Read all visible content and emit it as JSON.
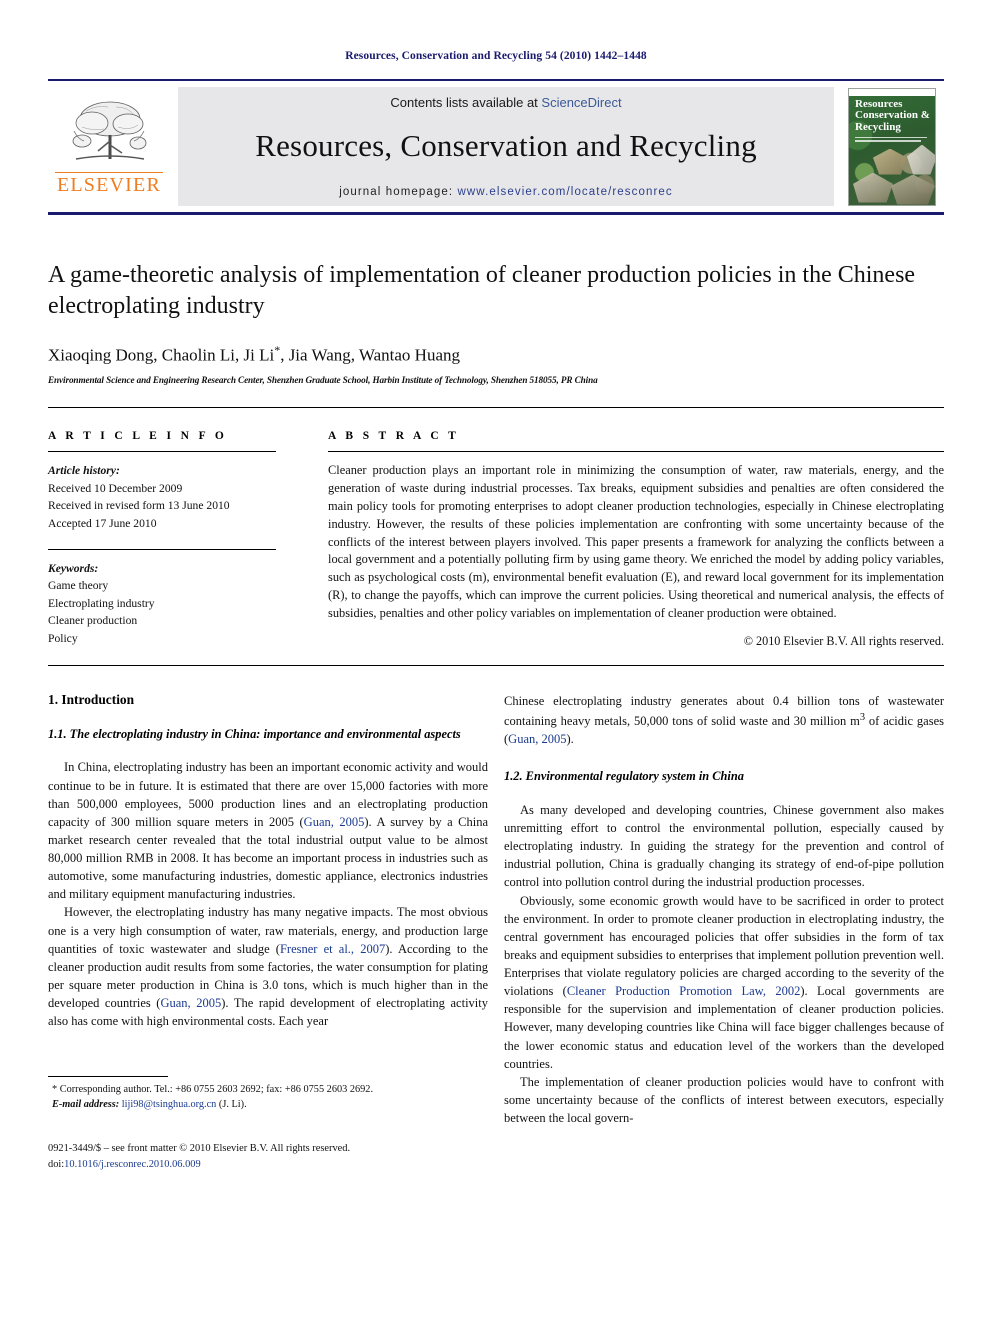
{
  "running_head": "Resources, Conservation and Recycling 54 (2010) 1442–1448",
  "masthead": {
    "publisher_name": "ELSEVIER",
    "contents_prefix": "Contents lists available at ",
    "contents_link": "ScienceDirect",
    "journal_name": "Resources, Conservation and Recycling",
    "homepage_label": "journal homepage:",
    "homepage_url": "www.elsevier.com/locate/resconrec",
    "cover_title_line1": "Resources",
    "cover_title_line2": "Conservation &",
    "cover_title_line3": "Recycling",
    "accent_color": "#1a1a6e",
    "logo_color": "#ef7d21"
  },
  "article": {
    "title": "A game-theoretic analysis of implementation of cleaner production policies in the Chinese electroplating industry",
    "authors": "Xiaoqing Dong, Chaolin Li, Ji Li",
    "authors_marker": "*",
    "authors_rest": ", Jia Wang, Wantao Huang",
    "affiliation": "Environmental Science and Engineering Research Center, Shenzhen Graduate School, Harbin Institute of Technology, Shenzhen 518055, PR China"
  },
  "article_info": {
    "heading": "A R T I C L E   I N F O",
    "history_label": "Article history:",
    "history": [
      "Received 10 December 2009",
      "Received in revised form 13 June 2010",
      "Accepted 17 June 2010"
    ],
    "keywords_label": "Keywords:",
    "keywords": [
      "Game theory",
      "Electroplating industry",
      "Cleaner production",
      "Policy"
    ]
  },
  "abstract": {
    "heading": "A B S T R A C T",
    "text": "Cleaner production plays an important role in minimizing the consumption of water, raw materials, energy, and the generation of waste during industrial processes. Tax breaks, equipment subsidies and penalties are often considered the main policy tools for promoting enterprises to adopt cleaner production technologies, especially in Chinese electroplating industry. However, the results of these policies implementation are confronting with some uncertainty because of the conflicts of the interest between players involved. This paper presents a framework for analyzing the conflicts between a local government and a potentially polluting firm by using game theory. We enriched the model by adding policy variables, such as psychological costs (m), environmental benefit evaluation (E), and reward local government for its implementation (R), to change the payoffs, which can improve the current policies. Using theoretical and numerical analysis, the effects of subsidies, penalties and other policy variables on implementation of cleaner production were obtained.",
    "copyright": "© 2010 Elsevier B.V. All rights reserved."
  },
  "sections": {
    "intro_heading": "1.  Introduction",
    "sub_1_1": "1.1.  The electroplating industry in China: importance and environmental aspects",
    "sub_1_2": "1.2.  Environmental regulatory system in China"
  },
  "paragraphs": {
    "left_p1_a": "In China, electroplating industry has been an important economic activity and would continue to be in future. It is estimated that there are over 15,000 factories with more than 500,000 employees, 5000 production lines and an electroplating production capacity of 300 million square meters in 2005 (",
    "left_p1_cite1": "Guan, 2005",
    "left_p1_b": "). A survey by a China market research center revealed that the total industrial output value to be almost 80,000 million RMB in 2008. It has become an important process in industries such as automotive, some manufacturing industries, domestic appliance, electronics industries and military equipment manufacturing industries.",
    "left_p2_a": "However, the electroplating industry has many negative impacts. The most obvious one is a very high consumption of water, raw materials, energy, and production large quantities of toxic wastewater and sludge (",
    "left_p2_cite1": "Fresner et al., 2007",
    "left_p2_b": "). According to the cleaner production audit results from some factories, the water consumption for plating per square meter production in China is 3.0 tons, which is much higher than in the developed countries (",
    "left_p2_cite2": "Guan, 2005",
    "left_p2_c": "). The rapid development of electroplating activity also has come with high environmental costs. Each year",
    "right_p1_a": "Chinese electroplating industry generates about 0.4 billion tons of wastewater containing heavy metals, 50,000 tons of solid waste and 30 million m",
    "right_p1_sup": "3",
    "right_p1_b": " of acidic gases (",
    "right_p1_cite": "Guan, 2005",
    "right_p1_c": ").",
    "right_p2": "As many developed and developing countries, Chinese government also makes unremitting effort to control the environmental pollution, especially caused by electroplating industry. In guiding the strategy for the prevention and control of industrial pollution, China is gradually changing its strategy of end-of-pipe pollution control into pollution control during the industrial production processes.",
    "right_p3_a": "Obviously, some economic growth would have to be sacrificed in order to protect the environment. In order to promote cleaner production in electroplating industry, the central government has encouraged policies that offer subsidies in the form of tax breaks and equipment subsidies to enterprises that implement pollution prevention well. Enterprises that violate regulatory policies are charged according to the severity of the violations (",
    "right_p3_cite": "Cleaner Production Promotion Law, 2002",
    "right_p3_b": "). Local governments are responsible for the supervision and implementation of cleaner production policies. However, many developing countries like China will face bigger challenges because of the lower economic status and education level of the workers than the developed countries.",
    "right_p4": "The implementation of cleaner production policies would have to confront with some uncertainty because of the conflicts of interest between executors, especially between the local govern-"
  },
  "footnotes": {
    "corresponding": "* Corresponding author. Tel.: +86 0755 2603 2692; fax: +86 0755 2603 2692.",
    "email_label": "E-mail address:",
    "email": "liji98@tsinghua.org.cn",
    "email_owner": "(J. Li).",
    "issn_line": "0921-3449/$ – see front matter © 2010 Elsevier B.V. All rights reserved.",
    "doi_label": "doi:",
    "doi_value": "10.1016/j.resconrec.2010.06.009"
  }
}
